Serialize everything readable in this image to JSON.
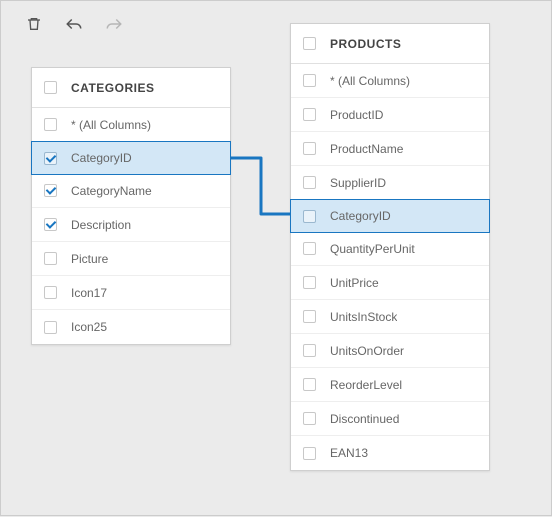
{
  "toolbar": {
    "delete_tooltip": "Delete",
    "undo_tooltip": "Undo",
    "redo_tooltip": "Redo"
  },
  "tables": {
    "categories": {
      "title": "CATEGORIES",
      "columns": [
        {
          "name": "* (All Columns)",
          "checked": false,
          "selected": false
        },
        {
          "name": "CategoryID",
          "checked": true,
          "selected": true
        },
        {
          "name": "CategoryName",
          "checked": true,
          "selected": false
        },
        {
          "name": "Description",
          "checked": true,
          "selected": false
        },
        {
          "name": "Picture",
          "checked": false,
          "selected": false
        },
        {
          "name": "Icon17",
          "checked": false,
          "selected": false
        },
        {
          "name": "Icon25",
          "checked": false,
          "selected": false
        }
      ]
    },
    "products": {
      "title": "PRODUCTS",
      "columns": [
        {
          "name": "* (All Columns)",
          "checked": false,
          "selected": false
        },
        {
          "name": "ProductID",
          "checked": false,
          "selected": false
        },
        {
          "name": "ProductName",
          "checked": false,
          "selected": false
        },
        {
          "name": "SupplierID",
          "checked": false,
          "selected": false
        },
        {
          "name": "CategoryID",
          "checked": false,
          "selected": true
        },
        {
          "name": "QuantityPerUnit",
          "checked": false,
          "selected": false
        },
        {
          "name": "UnitPrice",
          "checked": false,
          "selected": false
        },
        {
          "name": "UnitsInStock",
          "checked": false,
          "selected": false
        },
        {
          "name": "UnitsOnOrder",
          "checked": false,
          "selected": false
        },
        {
          "name": "ReorderLevel",
          "checked": false,
          "selected": false
        },
        {
          "name": "Discontinued",
          "checked": false,
          "selected": false
        },
        {
          "name": "EAN13",
          "checked": false,
          "selected": false
        }
      ]
    }
  },
  "relation": {
    "from": {
      "table": "categories",
      "column": "CategoryID"
    },
    "to": {
      "table": "products",
      "column": "CategoryID"
    }
  },
  "colors": {
    "accent": "#1976c1",
    "highlight_bg": "#d3e7f6"
  }
}
